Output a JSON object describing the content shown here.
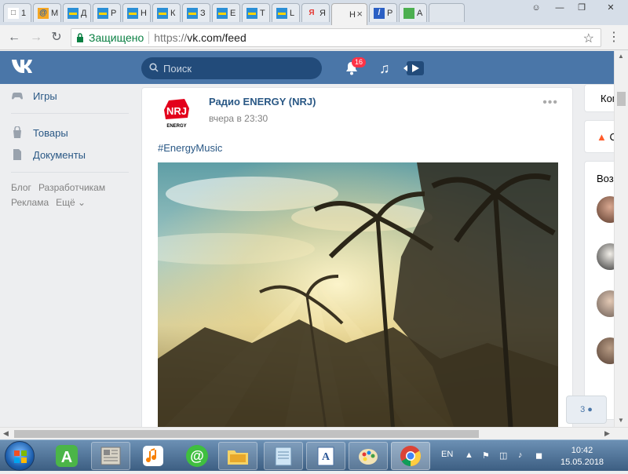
{
  "browser": {
    "tabs": [
      {
        "label": "1",
        "icon": "page-icon"
      },
      {
        "label": "M",
        "icon": "mail-at-icon"
      },
      {
        "label": "Д",
        "icon": "card-icon"
      },
      {
        "label": "Р",
        "icon": "card-icon"
      },
      {
        "label": "Н",
        "icon": "card-icon"
      },
      {
        "label": "К",
        "icon": "card-icon"
      },
      {
        "label": "З",
        "icon": "card-icon"
      },
      {
        "label": "Е",
        "icon": "card-icon"
      },
      {
        "label": "Т",
        "icon": "card-icon"
      },
      {
        "label": "L",
        "icon": "card-icon"
      },
      {
        "label": "Я",
        "icon": "yandex-icon"
      },
      {
        "label": "Н",
        "icon": "vk-icon"
      },
      {
        "label": "Р",
        "icon": "slash-icon"
      },
      {
        "label": "А",
        "icon": "green-square-icon"
      }
    ],
    "secure_label": "Защищено",
    "url_scheme": "https://",
    "url_host": "vk.com/feed"
  },
  "vk": {
    "search_placeholder": "Поиск",
    "notifications_count": "16",
    "leftnav": {
      "items": [
        {
          "label": "Игры",
          "icon": "gamepad-icon"
        },
        {
          "label": "Товары",
          "icon": "bag-icon"
        },
        {
          "label": "Документы",
          "icon": "document-icon"
        }
      ],
      "footer": [
        "Блог",
        "Разработчикам",
        "Реклама",
        "Ещё ⌄"
      ]
    },
    "post": {
      "author": "Радио ENERGY (NRJ)",
      "time": "вчера в 23:30",
      "tag": "#EnergyMusic",
      "avatar_text": "NRJ",
      "avatar_sub": "ENERGY"
    },
    "right": {
      "card1": "Ком",
      "card2": "С",
      "card3": "Воз"
    },
    "chat_count": "3"
  },
  "taskbar": {
    "lang": "EN",
    "time": "10:42",
    "date": "15.05.2018"
  },
  "colors": {
    "vk_blue": "#4a76a8",
    "link": "#2a5885",
    "badge": "#ff3347"
  }
}
